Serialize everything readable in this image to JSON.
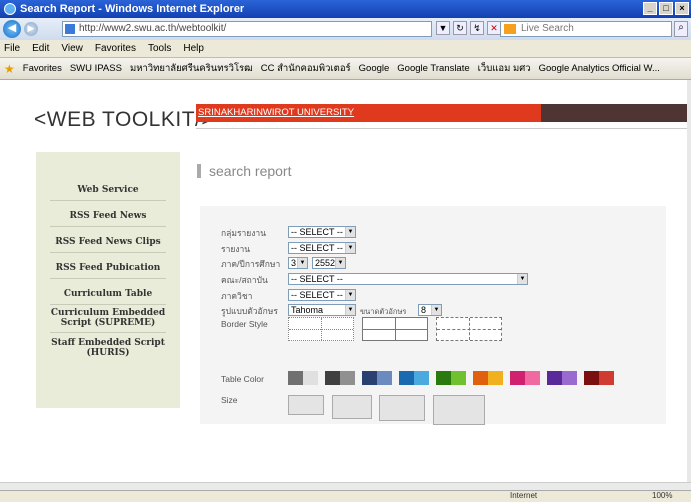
{
  "window": {
    "title": "Search Report - Windows Internet Explorer"
  },
  "address": {
    "url": "http://www2.swu.ac.th/webtoolkit/",
    "search_placeholder": "Live Search"
  },
  "menu": [
    "File",
    "Edit",
    "View",
    "Favorites",
    "Tools",
    "Help"
  ],
  "favorites": {
    "label": "Favorites",
    "items": [
      "SWU IPASS",
      "มหาวิทยาลัยศรีนครินทรวิโรฒ",
      "CC สำนักคอมพิวเตอร์",
      "Google",
      "Google Translate",
      "เว็บแอม มศว",
      "Google Analytics Official W..."
    ]
  },
  "site": {
    "logo": "<WEB TOOLKIT/>",
    "university": "SRINAKHARINWIROT UNIVERSITY"
  },
  "sidebar": {
    "items": [
      "Web Service",
      "RSS Feed News",
      "RSS Feed News Clips",
      "RSS Feed Pubication",
      "Curriculum Table",
      "Curriculum Embedded Script (SUPREME)",
      "Staff Embedded Script (HURIS)"
    ]
  },
  "page": {
    "title": "search report"
  },
  "form": {
    "report_group_label": "กลุ่มรายงาน",
    "report_group_value": "-- SELECT --",
    "report_label": "รายงาน",
    "report_value": "-- SELECT --",
    "term_label": "ภาค/ปีการศึกษา",
    "term_value": "3",
    "year_value": "2552",
    "faculty_label": "คณะ/สถาบัน",
    "faculty_value": "-- SELECT --",
    "dept_label": "ภาควิชา",
    "dept_value": "-- SELECT --",
    "font_label": "รูปแบบตัวอักษร",
    "font_value": "Tahoma",
    "fontsize_label": "ขนาดตัวอักษร",
    "fontsize_value": "8",
    "border_label": "Border Style",
    "color_label": "Table Color",
    "size_label": "Size"
  },
  "colors": {
    "swatches": [
      [
        "#707070",
        "#e0e0e0"
      ],
      [
        "#404040",
        "#909090"
      ],
      [
        "#2a4070",
        "#6a8ac0"
      ],
      [
        "#1a6ab0",
        "#4aaae0"
      ],
      [
        "#2a7a10",
        "#70c030"
      ],
      [
        "#e06010",
        "#f0b020"
      ],
      [
        "#d02070",
        "#f06aa0"
      ],
      [
        "#5a2a9a",
        "#9a6ad0"
      ],
      [
        "#7a1010",
        "#d03a30"
      ]
    ]
  },
  "status": {
    "zone": "Internet",
    "zoom": "100%"
  }
}
